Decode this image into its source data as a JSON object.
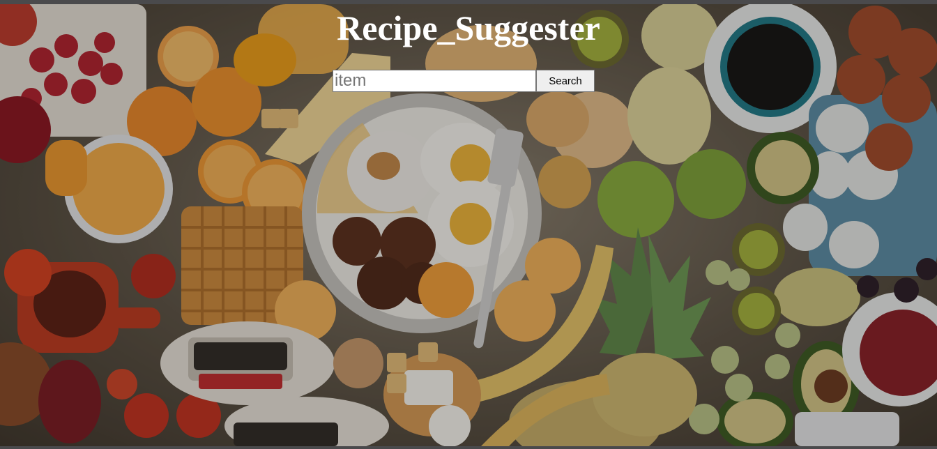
{
  "header": {
    "title": "Recipe_Suggester"
  },
  "search": {
    "placeholder": "item",
    "value": "",
    "button_label": "Search"
  },
  "background": {
    "subject": "breakfast-food-spread-photo",
    "overlay_color": "#141210"
  },
  "colors": {
    "title_text": "#ffffff",
    "input_background": "#ffffff",
    "button_background": "#efefef",
    "frame": "#4a4a4c"
  }
}
